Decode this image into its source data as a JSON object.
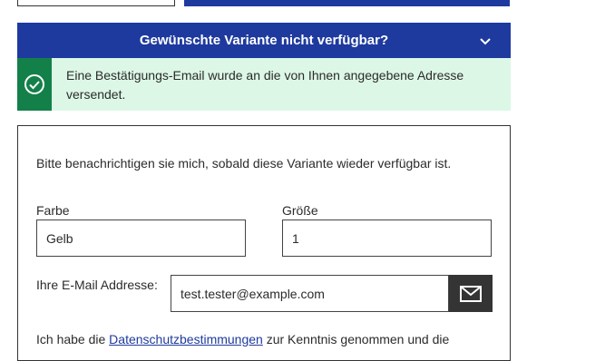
{
  "notify_bar": {
    "title": "Gewünschte Variante nicht verfügbar?"
  },
  "alert": {
    "message": "Eine Bestätigungs-Email wurde an die von Ihnen angegebene Adresse versendet."
  },
  "form": {
    "intro": "Bitte benachrichtigen sie mich, sobald diese Variante wieder verfügbar ist.",
    "color_label": "Farbe",
    "color_value": "Gelb",
    "size_label": "Größe",
    "size_value": "1",
    "email_label": "Ihre E-Mail Addresse:",
    "email_value": "test.tester@example.com",
    "privacy_prefix": "Ich habe die ",
    "privacy_link": "Datenschutzbestimmungen",
    "privacy_suffix": " zur Kenntnis genommen und die"
  },
  "icons": {
    "chevron": "chevron-down-icon",
    "check": "check-circle-icon",
    "mail": "mail-icon"
  },
  "colors": {
    "primary": "#1e3a9e",
    "success": "#13804a",
    "success_bg": "#dcf7e6",
    "button_dark": "#343434"
  }
}
